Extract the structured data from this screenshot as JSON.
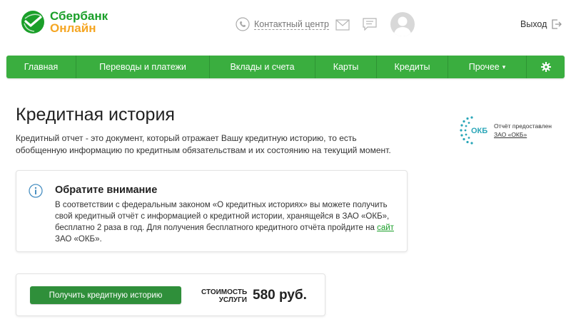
{
  "brand": {
    "line1": "Сбербанк",
    "line2": "Онлайн",
    "green": "#1a9f29",
    "orange": "#f5a623"
  },
  "header": {
    "contact_label": "Контактный центр",
    "logout_label": "Выход",
    "icons": [
      "phone-icon",
      "mail-icon",
      "chat-icon",
      "avatar",
      "logout-icon"
    ]
  },
  "nav": {
    "color": "#3aae3f",
    "items": [
      {
        "label": "Главная"
      },
      {
        "label": "Переводы и платежи"
      },
      {
        "label": "Вклады и счета"
      },
      {
        "label": "Карты"
      },
      {
        "label": "Кредиты"
      },
      {
        "label": "Прочее"
      }
    ],
    "settings_icon": "gear-icon"
  },
  "page": {
    "title": "Кредитная история",
    "intro": "Кредитный отчет - это документ, который отражает Вашу кредитную историю, то есть обобщенную информацию по кредитным обязательствам и их состоянию на текущий момент."
  },
  "provider": {
    "logo_text": "ОКБ",
    "caption": "Отчёт предоставлен",
    "link": "ЗАО «ОКБ»"
  },
  "notice": {
    "title": "Обратите внимание",
    "body_before_link": "В соответствии с федеральным законом «О кредитных историях» вы можете получить свой кредитный отчёт с информацией о кредитной истории, хранящейся в ЗАО «ОКБ», бесплатно 2 раза в год. Для получения бесплатного кредитного отчёта пройдите на ",
    "link": "сайт",
    "body_after_link": " ЗАО «ОКБ».",
    "icon": "info-icon"
  },
  "action": {
    "button_label": "Получить кредитную историю",
    "cost_label_line1": "СТОИМОСТЬ",
    "cost_label_line2": "УСЛУГИ",
    "cost_value": "580 руб.",
    "button_color": "#2f8f3a"
  }
}
